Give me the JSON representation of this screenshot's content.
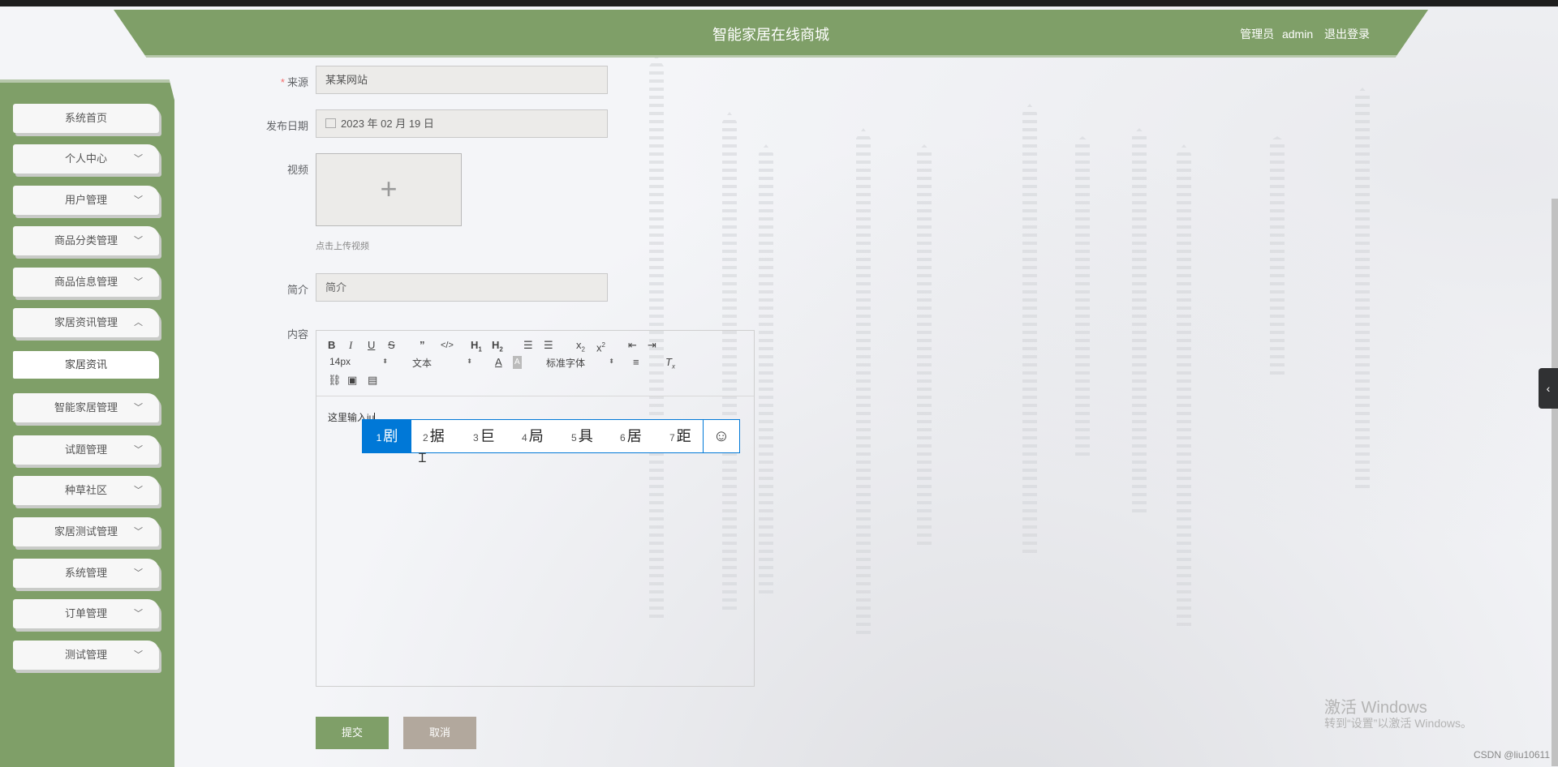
{
  "header": {
    "title": "智能家居在线商城",
    "role": "管理员",
    "username": "admin",
    "logout": "退出登录"
  },
  "sidebar": {
    "items": [
      {
        "label": "系统首页"
      },
      {
        "label": "个人中心"
      },
      {
        "label": "用户管理"
      },
      {
        "label": "商品分类管理"
      },
      {
        "label": "商品信息管理"
      },
      {
        "label": "家居资讯管理"
      },
      {
        "label": "家居资讯"
      },
      {
        "label": "智能家居管理"
      },
      {
        "label": "试题管理"
      },
      {
        "label": "种草社区"
      },
      {
        "label": "家居测试管理"
      },
      {
        "label": "系统管理"
      },
      {
        "label": "订单管理"
      },
      {
        "label": "测试管理"
      }
    ]
  },
  "form": {
    "source_label": "来源",
    "source_value": "某某网站",
    "date_label": "发布日期",
    "date_value": "2023 年 02 月 19 日",
    "video_label": "视频",
    "upload_tip": "点击上传视频",
    "intro_label": "简介",
    "intro_placeholder": "简介",
    "content_label": "内容"
  },
  "editor": {
    "font_size": "14px",
    "block_type": "文本",
    "font_family": "标准字体",
    "text": "这里输入ju"
  },
  "ime": {
    "candidates": [
      {
        "n": "1",
        "c": "剧"
      },
      {
        "n": "2",
        "c": "据"
      },
      {
        "n": "3",
        "c": "巨"
      },
      {
        "n": "4",
        "c": "局"
      },
      {
        "n": "5",
        "c": "具"
      },
      {
        "n": "6",
        "c": "居"
      },
      {
        "n": "7",
        "c": "距"
      }
    ]
  },
  "buttons": {
    "submit": "提交",
    "cancel": "取消"
  },
  "watermark": {
    "line1": "激活 Windows",
    "line2": "转到“设置”以激活 Windows。",
    "csdn": "CSDN @liu10611"
  },
  "colors": {
    "brand_green": "#7f9f68",
    "cancel_brown": "#b2a89d",
    "ime_blue": "#0078d7"
  }
}
